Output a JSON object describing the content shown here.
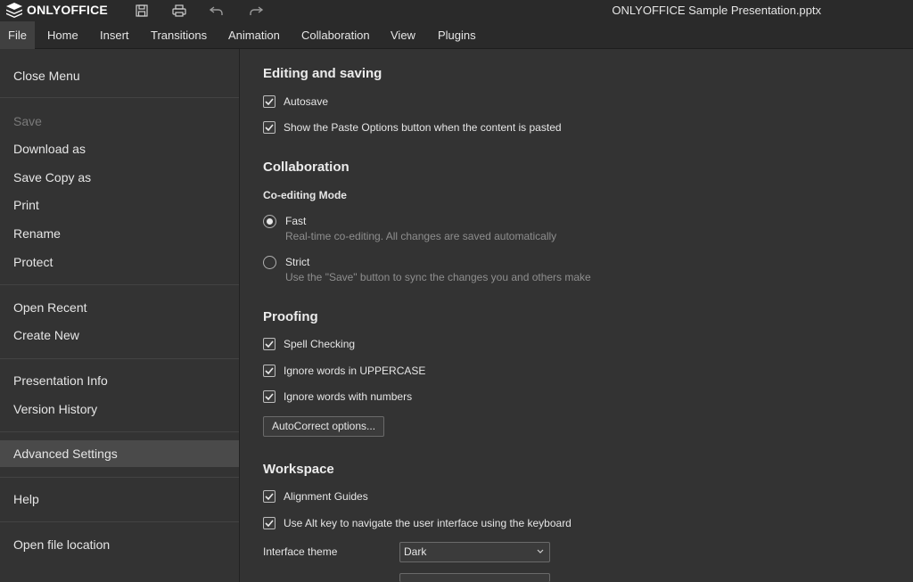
{
  "app": {
    "brand": "ONLYOFFICE",
    "document_title": "ONLYOFFICE Sample Presentation.pptx",
    "toolbar_icons": [
      "save-icon",
      "print-icon",
      "undo-icon",
      "redo-icon"
    ]
  },
  "tabs": [
    {
      "label": "File",
      "active": true
    },
    {
      "label": "Home"
    },
    {
      "label": "Insert"
    },
    {
      "label": "Transitions"
    },
    {
      "label": "Animation"
    },
    {
      "label": "Collaboration"
    },
    {
      "label": "View"
    },
    {
      "label": "Plugins"
    }
  ],
  "sidebar": {
    "items": [
      {
        "label": "Close Menu"
      },
      {
        "label": "Save",
        "disabled": true
      },
      {
        "label": "Download as"
      },
      {
        "label": "Save Copy as"
      },
      {
        "label": "Print"
      },
      {
        "label": "Rename"
      },
      {
        "label": "Protect"
      },
      {
        "label": "Open Recent"
      },
      {
        "label": "Create New"
      },
      {
        "label": "Presentation Info"
      },
      {
        "label": "Version History"
      },
      {
        "label": "Advanced Settings",
        "active": true
      },
      {
        "label": "Help"
      },
      {
        "label": "Open file location"
      }
    ]
  },
  "settings": {
    "editing": {
      "heading": "Editing and saving",
      "autosave": {
        "label": "Autosave",
        "checked": true
      },
      "paste_options": {
        "label": "Show the Paste Options button when the content is pasted",
        "checked": true
      }
    },
    "collaboration": {
      "heading": "Collaboration",
      "mode_label": "Co-editing Mode",
      "fast": {
        "title": "Fast",
        "desc": "Real-time co-editing. All changes are saved automatically",
        "selected": true
      },
      "strict": {
        "title": "Strict",
        "desc": "Use the \"Save\" button to sync the changes you and others make",
        "selected": false
      }
    },
    "proofing": {
      "heading": "Proofing",
      "spell": {
        "label": "Spell Checking",
        "checked": true
      },
      "uppercase": {
        "label": "Ignore words in UPPERCASE",
        "checked": true
      },
      "numbers": {
        "label": "Ignore words with numbers",
        "checked": true
      },
      "autocorrect_button": "AutoCorrect options..."
    },
    "workspace": {
      "heading": "Workspace",
      "guides": {
        "label": "Alignment Guides",
        "checked": true
      },
      "altkey": {
        "label": "Use Alt key to navigate the user interface using the keyboard",
        "checked": true
      },
      "theme_label": "Interface theme",
      "theme_value": "Dark"
    }
  }
}
